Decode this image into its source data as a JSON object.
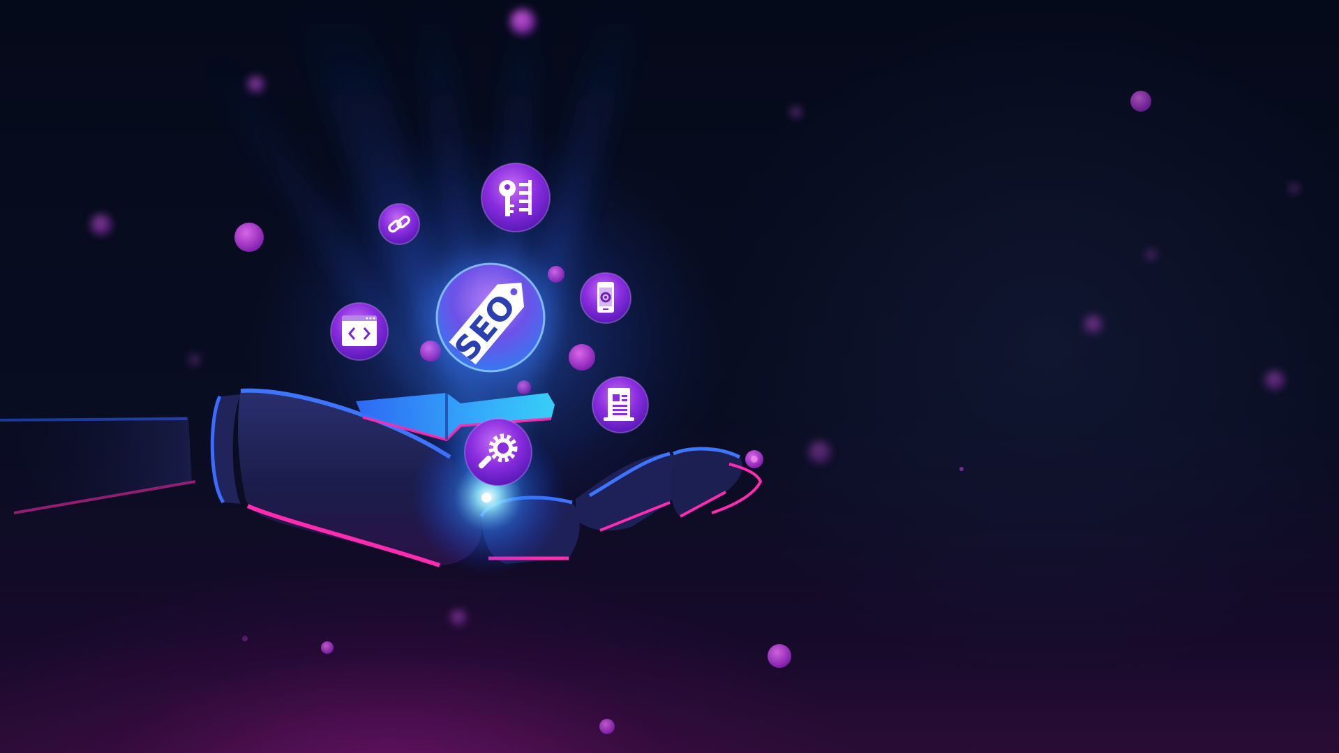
{
  "scene": {
    "seo_tag": {
      "label": "SEO"
    },
    "icons": [
      "seo-tag-icon",
      "keyword-key-icon",
      "link-chain-icon",
      "code-window-icon",
      "mobile-settings-icon",
      "document-icon",
      "search-gear-icon"
    ],
    "colors": {
      "background": "#070b1c",
      "bubble_purple": "#9b2fe0",
      "bubble_magenta": "#c23ad8",
      "glow_blue": "#1e6dff",
      "cyan_highlight": "#3ad8ff",
      "hand_edge_pink": "#ff2bb0"
    }
  }
}
